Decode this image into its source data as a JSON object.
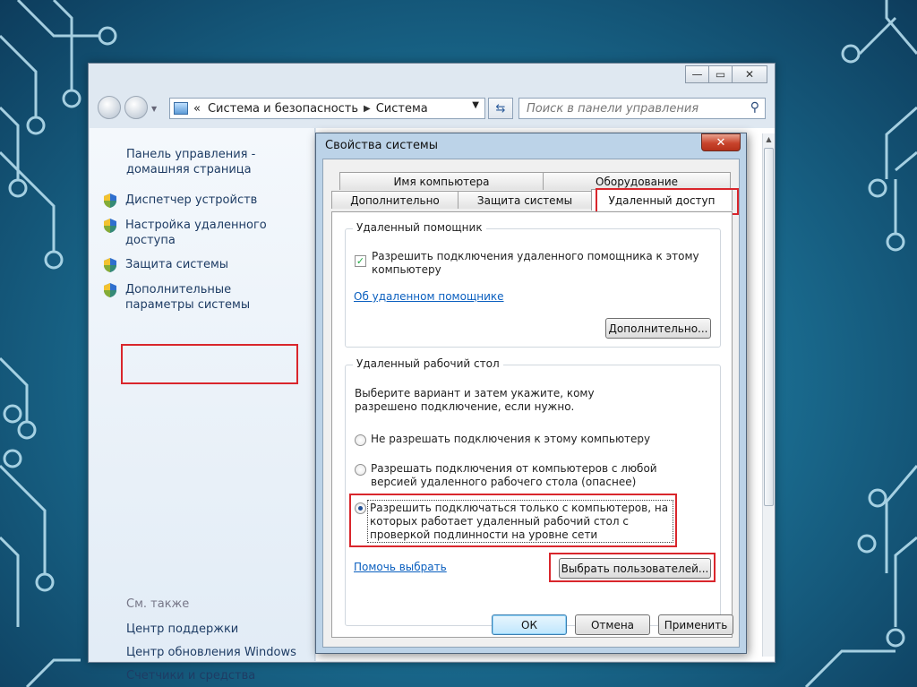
{
  "window": {
    "caption_buttons": [
      "—",
      "▭",
      "✕"
    ],
    "address": {
      "prefix": "«",
      "crumb1": "Система и безопасность",
      "crumb2": "Система"
    },
    "search_placeholder": "Поиск в панели управления"
  },
  "left_pane": {
    "home_link": "Панель управления - домашняя страница",
    "items": [
      {
        "label": "Диспетчер устройств",
        "icon": "uac-shield-icon"
      },
      {
        "label": "Настройка удаленного доступа",
        "icon": "uac-shield-icon"
      },
      {
        "label": "Защита системы",
        "icon": "uac-shield-icon"
      },
      {
        "label": "Дополнительные параметры системы",
        "icon": "uac-shield-icon",
        "highlighted": true
      }
    ],
    "see_also_label": "См. также",
    "see_also": [
      "Центр поддержки",
      "Центр обновления Windows",
      "Счетчики и средства производительности"
    ]
  },
  "dialog": {
    "title": "Свойства системы",
    "close": "✕",
    "tabs_row1": [
      "Имя компьютера",
      "Оборудование"
    ],
    "tabs_row2": [
      "Дополнительно",
      "Защита системы",
      "Удаленный доступ"
    ],
    "active_tab": "Удаленный доступ",
    "assistance": {
      "group_title": "Удаленный помощник",
      "checkbox_label": "Разрешить подключения удаленного помощника к этому компьютеру",
      "checkbox_checked": true,
      "link": "Об удаленном помощнике",
      "advanced_button": "Дополнительно..."
    },
    "desktop": {
      "group_title": "Удаленный рабочий стол",
      "description": "Выберите вариант и затем укажите, кому разрешено подключение, если нужно.",
      "options": [
        {
          "label": "Не разрешать подключения к этому компьютеру",
          "selected": false
        },
        {
          "label": "Разрешать подключения от компьютеров с любой версией удаленного рабочего стола (опаснее)",
          "selected": false
        },
        {
          "label": "Разрешить подключаться только с компьютеров, на которых работает удаленный рабочий стол с проверкой подлинности на уровне сети",
          "selected": true
        }
      ],
      "help_link": "Помочь выбрать",
      "select_users_button": "Выбрать пользователей..."
    },
    "buttons": {
      "ok": "ОК",
      "cancel": "Отмена",
      "apply": "Применить"
    }
  },
  "colors": {
    "highlight": "#d9262c",
    "link": "#0a5fbf",
    "nav_text": "#1e3c64"
  }
}
